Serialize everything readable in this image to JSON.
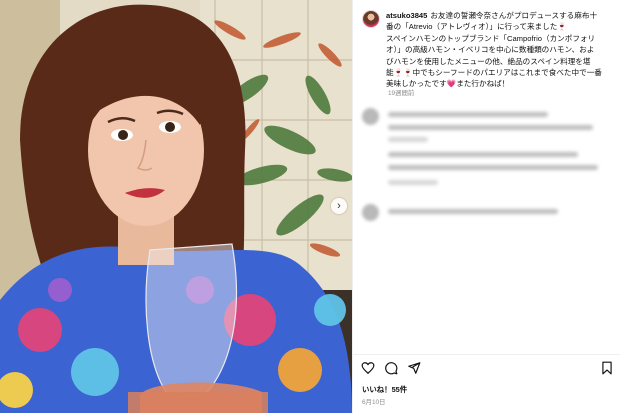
{
  "post": {
    "username": "atsuko3845",
    "caption_lines": [
      "お友達の誓瀬令奈さんがプロデュースする麻布十",
      "番の「Atrevio（アトレヴィオ）」に行って来ました🍷",
      "スペインハモンのトップブランド「Campofrio（カンポフォリ",
      "オ）」の高級ハモン・イベリコを中心に数種類のハモン、およ",
      "びハモンを使用したメニューの他、絶品のスペイン料理を堪",
      "能🍷🍷中でもシーフードのパエリアはこれまで食べた中で一番",
      "美味しかったです💗また行かねば！"
    ],
    "time_ago": "19週間前",
    "likes_label": "いいね！55件",
    "date": "6月10日"
  },
  "icons": {
    "like": "heart-icon",
    "comment": "comment-icon",
    "share": "share-icon",
    "save": "bookmark-icon",
    "next": "chevron-right-icon"
  },
  "colors": {
    "accent_blue": "#2a62d6",
    "muted_text": "#8e8e8e",
    "divider": "#efefef",
    "blurred_text": "#bdbdbd"
  }
}
